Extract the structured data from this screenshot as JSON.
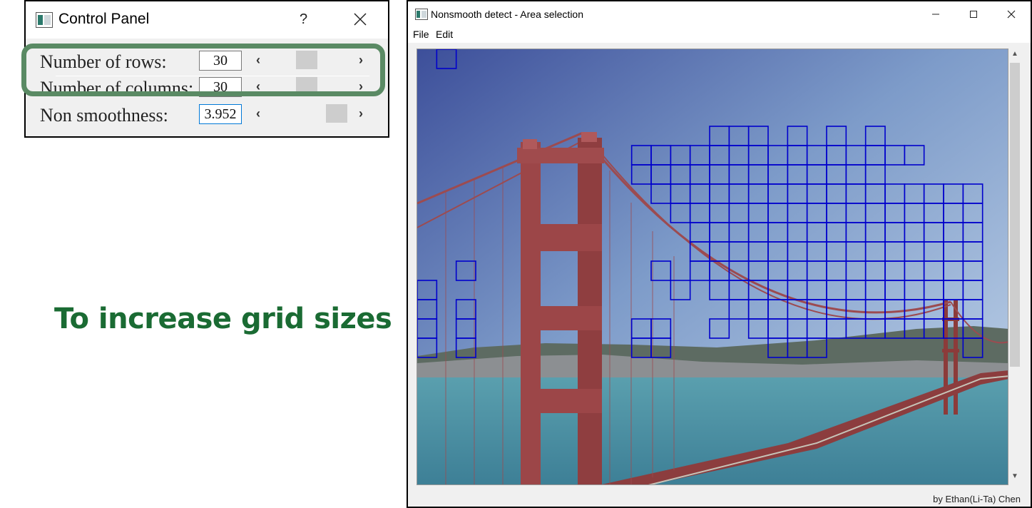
{
  "control_panel": {
    "title": "Control Panel",
    "help_label": "?",
    "rows": [
      {
        "label": "Number of rows:",
        "value": "30",
        "slider_fraction": 0.35
      },
      {
        "label": "Number of columns:",
        "value": "30",
        "slider_fraction": 0.35
      },
      {
        "label": "Non smoothness:",
        "value": "3.952",
        "slider_fraction": 0.86
      }
    ]
  },
  "caption": "To increase grid sizes",
  "main_window": {
    "title": "Nonsmooth detect - Area selection",
    "menu": [
      "File",
      "Edit"
    ],
    "credit": "by Ethan(Li-Ta) Chen"
  },
  "grid": {
    "columns": 30,
    "rows": 30,
    "selected_cells": [
      [
        0,
        1
      ],
      [
        4,
        15
      ],
      [
        4,
        16
      ],
      [
        4,
        17
      ],
      [
        4,
        19
      ],
      [
        4,
        21
      ],
      [
        4,
        23
      ],
      [
        5,
        11
      ],
      [
        5,
        12
      ],
      [
        5,
        13
      ],
      [
        5,
        14
      ],
      [
        5,
        15
      ],
      [
        5,
        16
      ],
      [
        5,
        17
      ],
      [
        5,
        18
      ],
      [
        5,
        19
      ],
      [
        5,
        20
      ],
      [
        5,
        21
      ],
      [
        5,
        22
      ],
      [
        5,
        23
      ],
      [
        5,
        24
      ],
      [
        5,
        25
      ],
      [
        6,
        11
      ],
      [
        6,
        12
      ],
      [
        6,
        13
      ],
      [
        6,
        14
      ],
      [
        6,
        15
      ],
      [
        6,
        16
      ],
      [
        6,
        17
      ],
      [
        6,
        18
      ],
      [
        6,
        19
      ],
      [
        6,
        20
      ],
      [
        6,
        21
      ],
      [
        6,
        22
      ],
      [
        6,
        23
      ],
      [
        7,
        12
      ],
      [
        7,
        13
      ],
      [
        7,
        14
      ],
      [
        7,
        15
      ],
      [
        7,
        16
      ],
      [
        7,
        17
      ],
      [
        7,
        18
      ],
      [
        7,
        19
      ],
      [
        7,
        20
      ],
      [
        7,
        21
      ],
      [
        7,
        22
      ],
      [
        7,
        23
      ],
      [
        7,
        24
      ],
      [
        7,
        25
      ],
      [
        7,
        26
      ],
      [
        7,
        27
      ],
      [
        7,
        28
      ],
      [
        8,
        13
      ],
      [
        8,
        14
      ],
      [
        8,
        15
      ],
      [
        8,
        16
      ],
      [
        8,
        17
      ],
      [
        8,
        18
      ],
      [
        8,
        19
      ],
      [
        8,
        20
      ],
      [
        8,
        21
      ],
      [
        8,
        22
      ],
      [
        8,
        23
      ],
      [
        8,
        24
      ],
      [
        8,
        25
      ],
      [
        8,
        26
      ],
      [
        8,
        27
      ],
      [
        8,
        28
      ],
      [
        9,
        14
      ],
      [
        9,
        15
      ],
      [
        9,
        16
      ],
      [
        9,
        17
      ],
      [
        9,
        18
      ],
      [
        9,
        19
      ],
      [
        9,
        20
      ],
      [
        9,
        21
      ],
      [
        9,
        22
      ],
      [
        9,
        23
      ],
      [
        9,
        24
      ],
      [
        9,
        25
      ],
      [
        9,
        26
      ],
      [
        9,
        27
      ],
      [
        9,
        28
      ],
      [
        10,
        14
      ],
      [
        10,
        15
      ],
      [
        10,
        16
      ],
      [
        10,
        17
      ],
      [
        10,
        18
      ],
      [
        10,
        19
      ],
      [
        10,
        20
      ],
      [
        10,
        21
      ],
      [
        10,
        22
      ],
      [
        10,
        23
      ],
      [
        10,
        24
      ],
      [
        10,
        25
      ],
      [
        10,
        26
      ],
      [
        10,
        27
      ],
      [
        10,
        28
      ],
      [
        11,
        2
      ],
      [
        11,
        12
      ],
      [
        11,
        14
      ],
      [
        11,
        15
      ],
      [
        11,
        16
      ],
      [
        11,
        17
      ],
      [
        11,
        18
      ],
      [
        11,
        19
      ],
      [
        11,
        20
      ],
      [
        11,
        21
      ],
      [
        11,
        22
      ],
      [
        11,
        23
      ],
      [
        11,
        24
      ],
      [
        11,
        25
      ],
      [
        11,
        26
      ],
      [
        11,
        27
      ],
      [
        11,
        28
      ],
      [
        12,
        0
      ],
      [
        12,
        13
      ],
      [
        12,
        15
      ],
      [
        12,
        16
      ],
      [
        12,
        17
      ],
      [
        12,
        18
      ],
      [
        12,
        19
      ],
      [
        12,
        20
      ],
      [
        12,
        21
      ],
      [
        12,
        22
      ],
      [
        12,
        23
      ],
      [
        12,
        24
      ],
      [
        12,
        25
      ],
      [
        12,
        26
      ],
      [
        12,
        27
      ],
      [
        12,
        28
      ],
      [
        13,
        0
      ],
      [
        13,
        2
      ],
      [
        13,
        16
      ],
      [
        13,
        17
      ],
      [
        13,
        18
      ],
      [
        13,
        19
      ],
      [
        13,
        20
      ],
      [
        13,
        21
      ],
      [
        13,
        22
      ],
      [
        13,
        23
      ],
      [
        13,
        24
      ],
      [
        13,
        25
      ],
      [
        13,
        26
      ],
      [
        13,
        27
      ],
      [
        13,
        28
      ],
      [
        14,
        0
      ],
      [
        14,
        2
      ],
      [
        14,
        11
      ],
      [
        14,
        12
      ],
      [
        14,
        15
      ],
      [
        14,
        17
      ],
      [
        14,
        18
      ],
      [
        14,
        19
      ],
      [
        14,
        20
      ],
      [
        14,
        21
      ],
      [
        14,
        22
      ],
      [
        14,
        23
      ],
      [
        14,
        24
      ],
      [
        14,
        25
      ],
      [
        14,
        26
      ],
      [
        14,
        27
      ],
      [
        14,
        28
      ],
      [
        15,
        0
      ],
      [
        15,
        2
      ],
      [
        15,
        11
      ],
      [
        15,
        12
      ],
      [
        15,
        18
      ],
      [
        15,
        19
      ],
      [
        15,
        20
      ],
      [
        15,
        28
      ]
    ]
  },
  "colors": {
    "grid_line": "#0000cc",
    "highlight": "#5a8a64",
    "caption": "#1a6b33"
  }
}
